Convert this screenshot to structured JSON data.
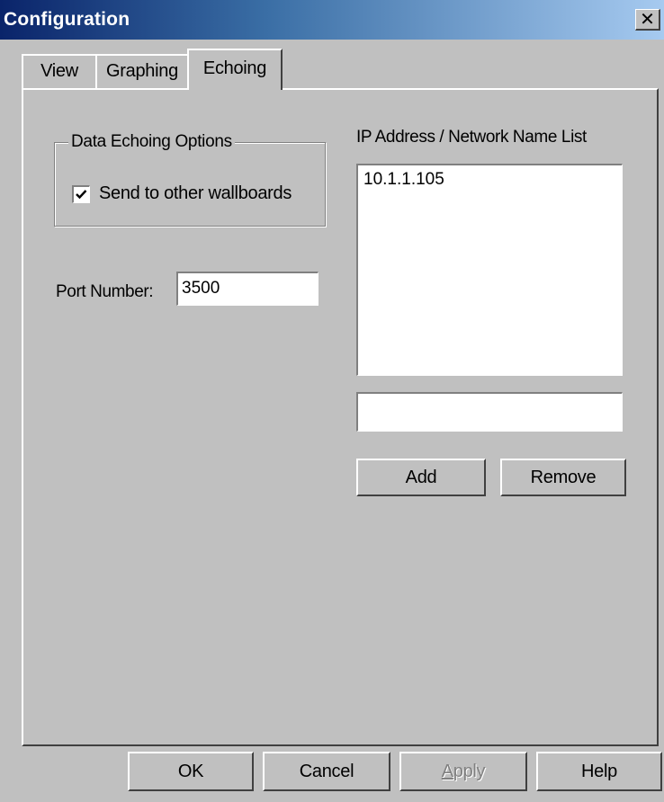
{
  "window": {
    "title": "Configuration",
    "close_glyph": "✕",
    "close_icon": "close-icon"
  },
  "tabs": [
    {
      "label": "View",
      "active": false
    },
    {
      "label": "Graphing",
      "active": false
    },
    {
      "label": "Echoing",
      "active": true
    }
  ],
  "echoing": {
    "group_label": "Data Echoing Options",
    "send_checkbox": {
      "label": "Send to other wallboards",
      "checked": true
    },
    "port_label": "Port Number:",
    "port_value": "3500",
    "ip_list_label": "IP Address / Network Name List",
    "ip_list_items": [
      "10.1.1.105"
    ],
    "ip_entry_value": "",
    "add_label": "Add",
    "remove_label": "Remove"
  },
  "footer": {
    "ok_label": "OK",
    "cancel_label": "Cancel",
    "apply_first": "A",
    "apply_rest": "pply",
    "apply_enabled": false,
    "help_label": "Help"
  },
  "colors": {
    "dialog_bg": "#c0c0c0",
    "title_gradient_start": "#0a246a",
    "title_gradient_end": "#a6caf0",
    "disabled_text": "#808080"
  }
}
